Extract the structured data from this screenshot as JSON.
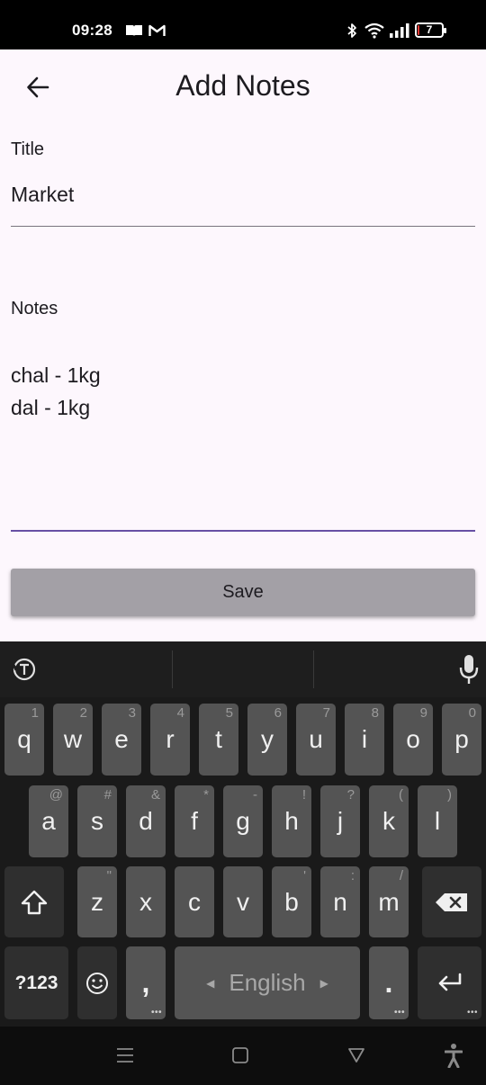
{
  "status": {
    "time": "09:28",
    "battery": "7",
    "battery_color": "#e53935"
  },
  "app_bar": {
    "title": "Add Notes"
  },
  "title_field": {
    "label": "Title",
    "value": "Market"
  },
  "notes_field": {
    "label": "Notes",
    "value": "chal - 1kg\ndal - 1kg"
  },
  "save_button": {
    "label": "Save"
  },
  "keyboard": {
    "row1": [
      {
        "k": "q",
        "h": "1"
      },
      {
        "k": "w",
        "h": "2"
      },
      {
        "k": "e",
        "h": "3"
      },
      {
        "k": "r",
        "h": "4"
      },
      {
        "k": "t",
        "h": "5"
      },
      {
        "k": "y",
        "h": "6"
      },
      {
        "k": "u",
        "h": "7"
      },
      {
        "k": "i",
        "h": "8"
      },
      {
        "k": "o",
        "h": "9"
      },
      {
        "k": "p",
        "h": "0"
      }
    ],
    "row2": [
      {
        "k": "a",
        "h": "@"
      },
      {
        "k": "s",
        "h": "#"
      },
      {
        "k": "d",
        "h": "&"
      },
      {
        "k": "f",
        "h": "*"
      },
      {
        "k": "g",
        "h": "-"
      },
      {
        "k": "h",
        "h": "!"
      },
      {
        "k": "j",
        "h": "?"
      },
      {
        "k": "k",
        "h": "("
      },
      {
        "k": "l",
        "h": ")"
      }
    ],
    "row3": [
      {
        "k": "z",
        "h": "\""
      },
      {
        "k": "x",
        "h": ""
      },
      {
        "k": "c",
        "h": ""
      },
      {
        "k": "v",
        "h": ""
      },
      {
        "k": "b",
        "h": "'"
      },
      {
        "k": "n",
        "h": ":"
      },
      {
        "k": "m",
        "h": "/"
      }
    ],
    "symbols_label": "?123",
    "comma": ",",
    "space_label": "English",
    "period": "."
  },
  "colors": {
    "background": "#fdf7fd",
    "accent": "#6750a4",
    "save_button": "#a3a0a6"
  }
}
